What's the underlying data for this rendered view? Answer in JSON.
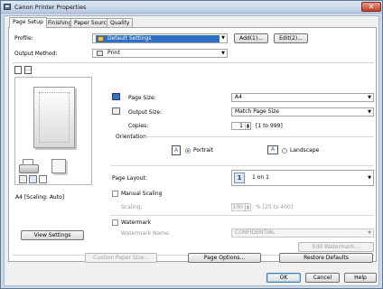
{
  "window": {
    "title": "Canon Printer Properties",
    "close_glyph": "✕"
  },
  "tabs": [
    "Page Setup",
    "Finishing",
    "Paper Source",
    "Quality"
  ],
  "profile": {
    "label": "Profile:",
    "value": "Default Settings",
    "add_label": "Add(1)...",
    "edit_label": "Edit(2)..."
  },
  "output_method": {
    "label": "Output Method:",
    "value": "Print"
  },
  "preview": {
    "caption": "A4 [Scaling: Auto]",
    "view_settings_label": "View Settings"
  },
  "page_size": {
    "label": "Page Size:",
    "value": "A4"
  },
  "output_size": {
    "label": "Output Size:",
    "value": "Match Page Size"
  },
  "copies": {
    "label": "Copies:",
    "value": "1",
    "range": "[1 to 999]"
  },
  "orientation": {
    "label": "Orientation",
    "portrait": "Portrait",
    "landscape": "Landscape",
    "selected": "Portrait"
  },
  "page_layout": {
    "label": "Page Layout:",
    "value": "1 on 1",
    "icon_text": "1"
  },
  "manual_scaling": {
    "label": "Manual Scaling",
    "checked": false,
    "scaling_label": "Scaling:",
    "scaling_value": "100",
    "scaling_range": "% [25 to 400]"
  },
  "watermark": {
    "label": "Watermark",
    "checked": false,
    "name_label": "Watermark Name:",
    "name_value": "CONFIDENTIAL",
    "edit_label": "Edit Watermark..."
  },
  "bottom_buttons": {
    "custom_paper_size": "Custom Paper Size...",
    "page_options": "Page Options...",
    "restore_defaults": "Restore Defaults"
  },
  "dialog_buttons": {
    "ok": "OK",
    "cancel": "Cancel",
    "help": "Help"
  },
  "colors": {
    "accent_blue": "#2f6fc4",
    "titlebar": "#c4d4e8",
    "close": "#c2402a"
  }
}
